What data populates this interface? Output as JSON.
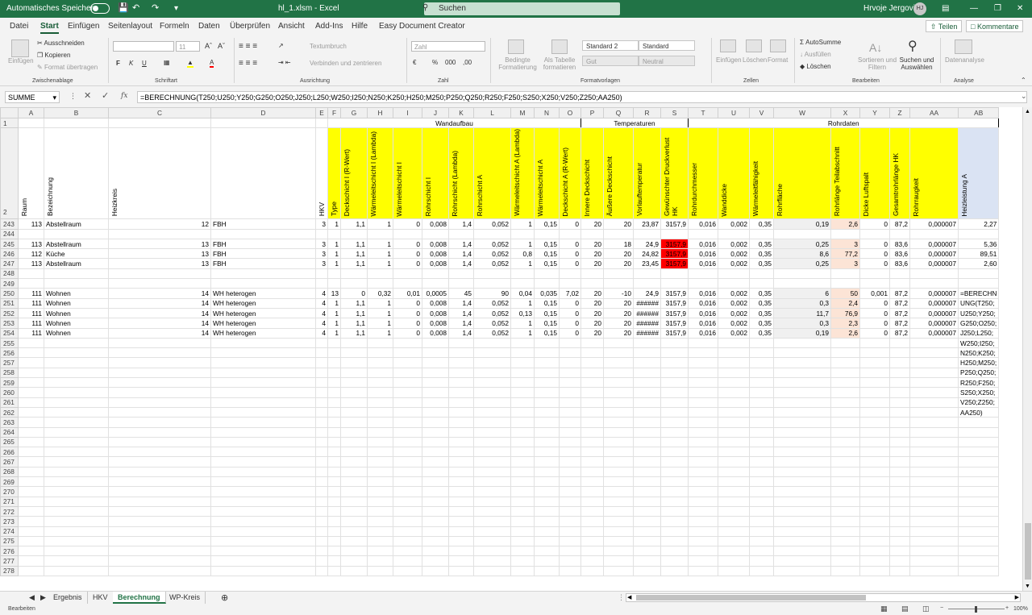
{
  "titlebar": {
    "autosave_label": "Automatisches Speichern",
    "filename": "hl_1.xlsm - Excel",
    "search_placeholder": "Suchen",
    "user_name": "Hrvoje Jergovic",
    "user_initials": "HJ"
  },
  "menu": {
    "tabs": [
      "Datei",
      "Start",
      "Einfügen",
      "Seitenlayout",
      "Formeln",
      "Daten",
      "Überprüfen",
      "Ansicht",
      "Add-Ins",
      "Hilfe",
      "Easy Document Creator"
    ],
    "active": "Start",
    "share_label": "Teilen",
    "comments_label": "Kommentare"
  },
  "ribbon": {
    "paste_label": "Einfügen",
    "cut_label": "Ausschneiden",
    "copy_label": "Kopieren",
    "format_painter_label": "Format übertragen",
    "clipboard_group": "Zwischenablage",
    "font_size": "11",
    "bold": "F",
    "italic": "K",
    "underline": "U",
    "font_group": "Schriftart",
    "wrap_text": "Textumbruch",
    "merge_center": "Verbinden und zentrieren",
    "alignment_group": "Ausrichtung",
    "number_format": "Zahl",
    "number_group": "Zahl",
    "conditional_format": "Bedingte Formatierung",
    "format_as_table": "Als Tabelle formatieren",
    "style_standard2": "Standard 2",
    "style_standard": "Standard",
    "style_gut": "Gut",
    "style_neutral": "Neutral",
    "styles_group": "Formatvorlagen",
    "insert": "Einfügen",
    "delete": "Löschen",
    "format": "Format",
    "cells_group": "Zellen",
    "autosum": "AutoSumme",
    "fill": "Ausfüllen",
    "clear": "Löschen",
    "sort_filter": "Sortieren und Filtern",
    "find_select": "Suchen und Auswählen",
    "editing_group": "Bearbeiten",
    "data_analysis": "Datenanalyse",
    "analysis_group": "Analyse"
  },
  "formula_bar": {
    "name_box": "SUMME",
    "formula": "=BERECHNUNG(T250;U250;Y250;G250;O250;J250;L250;W250;I250;N250;K250;H250;M250;P250;Q250;R250;F250;S250;X250;V250;Z250;AA250)"
  },
  "columns": [
    "A",
    "B",
    "C",
    "D",
    "E",
    "F",
    "G",
    "H",
    "I",
    "J",
    "K",
    "L",
    "M",
    "N",
    "O",
    "P",
    "Q",
    "R",
    "S",
    "T",
    "U",
    "V",
    "W",
    "X",
    "Y",
    "Z",
    "AA",
    "AB"
  ],
  "group_headers": {
    "wandaufbau": "Wandaufbau",
    "temperaturen": "Temperaturen",
    "rohrdaten": "Rohrdaten"
  },
  "header_row2": {
    "A": "Raum",
    "B": "Bezeichnung",
    "C": "Heizkreis",
    "D": "",
    "E": "HKV",
    "F": "Type",
    "G": "Deckschicht I (R-Wert)",
    "H": "Wärmeleitschicht I (Lambda)",
    "I": "Wärmeleitschicht I",
    "J": "Rohrschicht I",
    "K": "Rohrschicht (Lambda)",
    "L": "Rohrschicht A",
    "M": "Wärmeleitschicht A (Lambda)",
    "N": "Wärmeleitschicht A",
    "O": "Deckschicht A (R-Wert)",
    "P": "Innere Deckschicht",
    "Q": "Äußere Deckschicht",
    "R": "Vorlauftemperatur",
    "S": "Gewünschter Druckverlust HK",
    "T": "Rohrdurchmesser",
    "U": "Wanddicke",
    "V": "Wärmeleitfähigkeit",
    "W": "Rohrfläche",
    "X": "Rohrlänge Teilabschnitt",
    "Y": "Dicke Luftspalt",
    "Z": "Gesamtrohrlänge HK",
    "AA": "Rohrraugkeit",
    "AB": "Heizleistung A"
  },
  "rows": [
    {
      "n": "243",
      "c": [
        "113",
        "Abstellraum",
        "12",
        "FBH",
        "3",
        "1",
        "1,1",
        "1",
        "0",
        "0,008",
        "1,4",
        "0,052",
        "1",
        "0,15",
        "0",
        "20",
        "20",
        "23,87",
        "3157,9",
        "0,016",
        "0,002",
        "0,35",
        "0,19",
        "2,6",
        "0",
        "87,2",
        "0,000007",
        "2,27"
      ]
    },
    {
      "n": "244",
      "c": []
    },
    {
      "n": "245",
      "c": [
        "113",
        "Abstellraum",
        "13",
        "FBH",
        "3",
        "1",
        "1,1",
        "1",
        "0",
        "0,008",
        "1,4",
        "0,052",
        "1",
        "0,15",
        "0",
        "20",
        "18",
        "24,9",
        "3157,9",
        "0,016",
        "0,002",
        "0,35",
        "0,25",
        "3",
        "0",
        "83,6",
        "0,000007",
        "5,36"
      ]
    },
    {
      "n": "246",
      "c": [
        "112",
        "Küche",
        "13",
        "FBH",
        "3",
        "1",
        "1,1",
        "1",
        "0",
        "0,008",
        "1,4",
        "0,052",
        "0,8",
        "0,15",
        "0",
        "20",
        "20",
        "24,82",
        "3157,9",
        "0,016",
        "0,002",
        "0,35",
        "8,6",
        "77,2",
        "0",
        "83,6",
        "0,000007",
        "89,51"
      ]
    },
    {
      "n": "247",
      "c": [
        "113",
        "Abstellraum",
        "13",
        "FBH",
        "3",
        "1",
        "1,1",
        "1",
        "0",
        "0,008",
        "1,4",
        "0,052",
        "1",
        "0,15",
        "0",
        "20",
        "20",
        "23,45",
        "3157,9",
        "0,016",
        "0,002",
        "0,35",
        "0,25",
        "3",
        "0",
        "83,6",
        "0,000007",
        "2,60"
      ]
    },
    {
      "n": "248",
      "c": []
    },
    {
      "n": "249",
      "c": []
    },
    {
      "n": "250",
      "c": [
        "111",
        "Wohnen",
        "14",
        "WH heterogen",
        "4",
        "13",
        "0",
        "0,32",
        "0,01",
        "0,0005",
        "45",
        "90",
        "0,04",
        "0,035",
        "7,02",
        "20",
        "-10",
        "24,9",
        "3157,9",
        "0,016",
        "0,002",
        "0,35",
        "6",
        "50",
        "0,001",
        "87,2",
        "0,000007",
        "=BERECHN"
      ]
    },
    {
      "n": "251",
      "c": [
        "111",
        "Wohnen",
        "14",
        "WH heterogen",
        "4",
        "1",
        "1,1",
        "1",
        "0",
        "0,008",
        "1,4",
        "0,052",
        "1",
        "0,15",
        "0",
        "20",
        "20",
        "######",
        "3157,9",
        "0,016",
        "0,002",
        "0,35",
        "0,3",
        "2,4",
        "0",
        "87,2",
        "0,000007",
        "UNG(T250;"
      ]
    },
    {
      "n": "252",
      "c": [
        "111",
        "Wohnen",
        "14",
        "WH heterogen",
        "4",
        "1",
        "1,1",
        "1",
        "0",
        "0,008",
        "1,4",
        "0,052",
        "0,13",
        "0,15",
        "0",
        "20",
        "20",
        "######",
        "3157,9",
        "0,016",
        "0,002",
        "0,35",
        "11,7",
        "76,9",
        "0",
        "87,2",
        "0,000007",
        "U250;Y250;"
      ]
    },
    {
      "n": "253",
      "c": [
        "111",
        "Wohnen",
        "14",
        "WH heterogen",
        "4",
        "1",
        "1,1",
        "1",
        "0",
        "0,008",
        "1,4",
        "0,052",
        "1",
        "0,15",
        "0",
        "20",
        "20",
        "######",
        "3157,9",
        "0,016",
        "0,002",
        "0,35",
        "0,3",
        "2,3",
        "0",
        "87,2",
        "0,000007",
        "G250;O250;"
      ]
    },
    {
      "n": "254",
      "c": [
        "111",
        "Wohnen",
        "14",
        "WH heterogen",
        "4",
        "1",
        "1,1",
        "1",
        "0",
        "0,008",
        "1,4",
        "0,052",
        "1",
        "0,15",
        "0",
        "20",
        "20",
        "######",
        "3157,9",
        "0,016",
        "0,002",
        "0,35",
        "0,19",
        "2,6",
        "0",
        "87,2",
        "0,000007",
        "J250;L250;"
      ]
    }
  ],
  "overflow_formula": [
    "W250;I250;",
    "N250;K250;",
    "H250;M250;",
    "P250;Q250;",
    "R250;F250;",
    "S250;X250;",
    "V250;Z250;",
    "AA250)"
  ],
  "empty_row_start": 255,
  "empty_row_end": 278,
  "sheets": [
    "Ergebnis",
    "HKV",
    "Berechnung",
    "WP-Kreis"
  ],
  "active_sheet": "Berechnung",
  "status": {
    "mode": "Bearbeiten",
    "zoom": "100%"
  },
  "colors": {
    "excel_green": "#217346",
    "header_yellow": "#ffff00",
    "alert_red": "#ff0000",
    "peach": "#fce4d6",
    "blue_header": "#dae3f3"
  }
}
